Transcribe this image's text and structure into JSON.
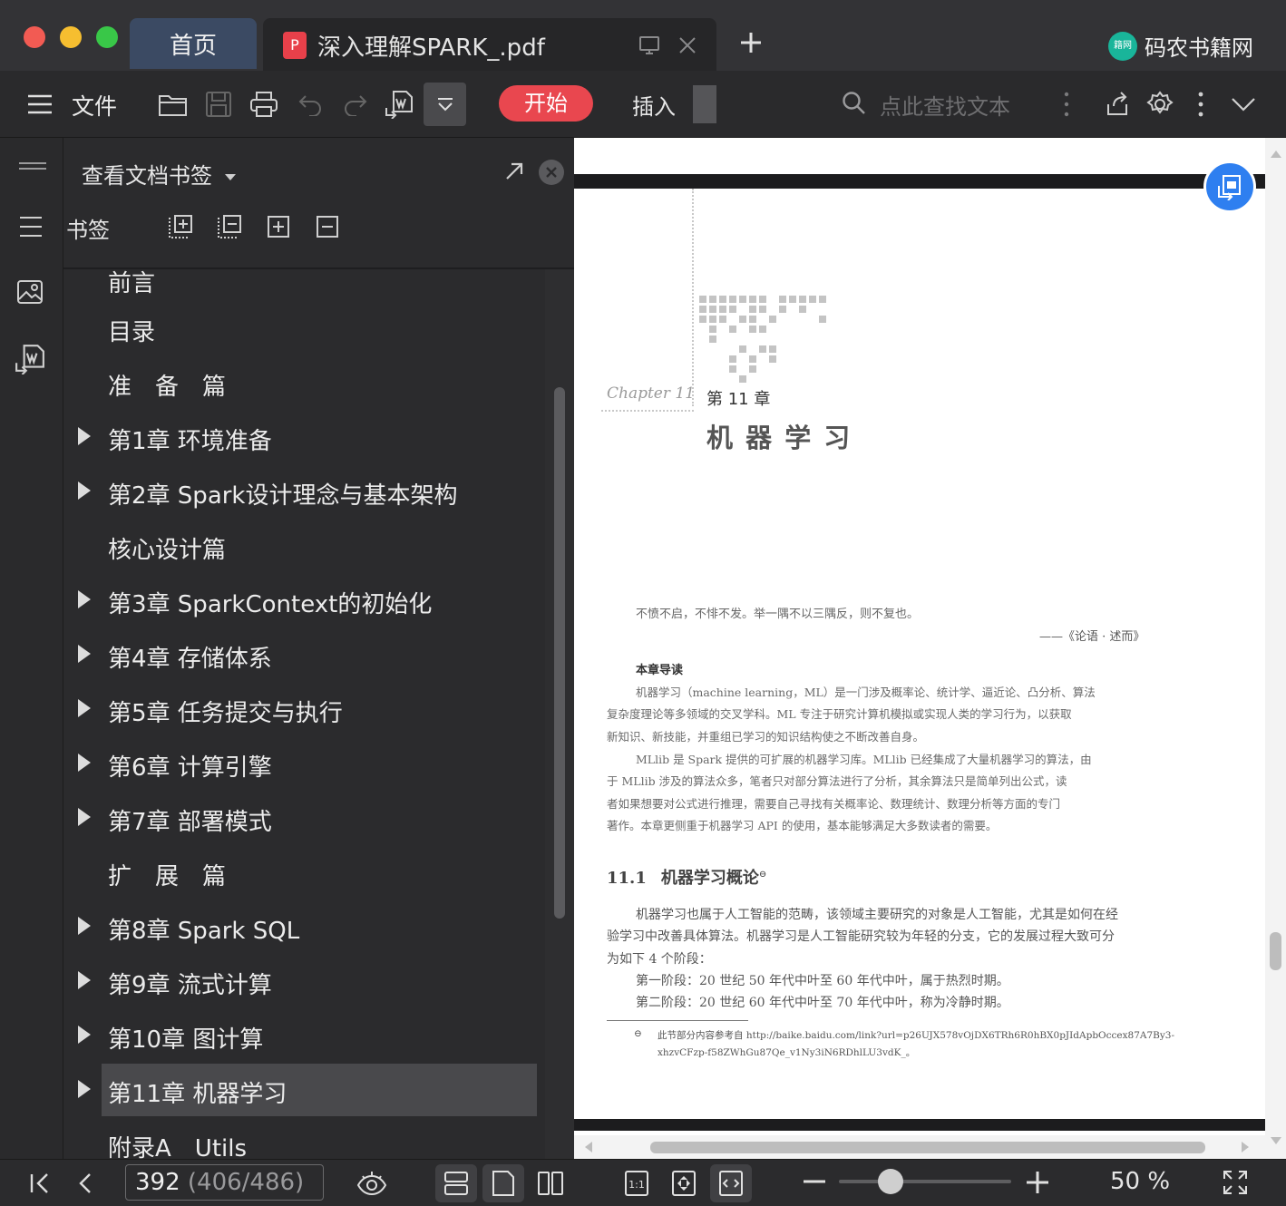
{
  "window": {
    "tabs": [
      {
        "label": "首页",
        "active": false
      },
      {
        "label": "深入理解SPARK_.pdf",
        "active": true
      }
    ],
    "brand": "码农书籍网",
    "brand_logo_text": "籍网"
  },
  "toolbar": {
    "file_label": "文件",
    "start_label": "开始",
    "insert_label": "插入",
    "search_placeholder": "点此查找文本",
    "accent": "#e9474f"
  },
  "sidebar": {
    "title": "查看文档书签",
    "label": "书签",
    "items": [
      {
        "label": "前言",
        "expandable": false
      },
      {
        "label": "目录",
        "expandable": false
      },
      {
        "label": "准　备　篇",
        "expandable": false
      },
      {
        "label": "第1章 环境准备",
        "expandable": true
      },
      {
        "label": "第2章 Spark设计理念与基本架构",
        "expandable": true
      },
      {
        "label": "核心设计篇",
        "expandable": false
      },
      {
        "label": "第3章 SparkContext的初始化",
        "expandable": true
      },
      {
        "label": "第4章 存储体系",
        "expandable": true
      },
      {
        "label": "第5章 任务提交与执行",
        "expandable": true
      },
      {
        "label": "第6章 计算引擎",
        "expandable": true
      },
      {
        "label": "第7章 部署模式",
        "expandable": true
      },
      {
        "label": "扩　展　篇",
        "expandable": false
      },
      {
        "label": "第8章 Spark SQL",
        "expandable": true
      },
      {
        "label": "第9章 流式计算",
        "expandable": true
      },
      {
        "label": "第10章 图计算",
        "expandable": true
      },
      {
        "label": "第11章 机器学习",
        "expandable": true,
        "selected": true
      },
      {
        "label": "附录A　Utils",
        "expandable": false
      }
    ]
  },
  "page": {
    "chapter_script": "Chapter 11",
    "chapter_num": "第 11 章",
    "chapter_title": "机 器 学 习",
    "quote": "不愤不启，不悱不发。举一隅不以三隅反，则不复也。",
    "quote_source": "——《论语 · 述而》",
    "intro_heading": "本章导读",
    "intro_p1_l1": "机器学习（machine learning，ML）是一门涉及概率论、统计学、逼近论、凸分析、算法",
    "intro_p1_l2": "复杂度理论等多领域的交叉学科。ML 专注于研究计算机模拟或实现人类的学习行为，以获取",
    "intro_p1_l3": "新知识、新技能，并重组已学习的知识结构使之不断改善自身。",
    "intro_p2_l1": "MLlib 是 Spark 提供的可扩展的机器学习库。MLlib 已经集成了大量机器学习的算法，由",
    "intro_p2_l2": "于 MLlib 涉及的算法众多，笔者只对部分算法进行了分析，其余算法只是简单列出公式，读",
    "intro_p2_l3": "者如果想要对公式进行推理，需要自己寻找有关概率论、数理统计、数理分析等方面的专门",
    "intro_p2_l4": "著作。本章更侧重于机器学习 API 的使用，基本能够满足大多数读者的需要。",
    "section_num": "11.1",
    "section_title": "机器学习概论",
    "footnote_mark": "⊖",
    "body_l1": "机器学习也属于人工智能的范畴，该领域主要研究的对象是人工智能，尤其是如何在经",
    "body_l2": "验学习中改善具体算法。机器学习是人工智能研究较为年轻的分支，它的发展过程大致可分",
    "body_l3": "为如下 4 个阶段：",
    "body_l4": "第一阶段：20 世纪 50 年代中叶至 60 年代中叶，属于热烈时期。",
    "body_l5": "第二阶段：20 世纪 60 年代中叶至 70 年代中叶，称为冷静时期。",
    "fn_l1": "此节部分内容参考自 http://baike.baidu.com/link?url=p26UJX578vOjDX6TRh6R0hBX0pJIdApbOccex87A7By3-",
    "fn_l2": "xhzvCFzp-f58ZWhGu87Qe_v1Ny3iN6RDhlLU3vdK_。"
  },
  "status": {
    "page_current": "392",
    "page_info": "(406/486)",
    "zoom": "50 %",
    "zoom_fraction": 0.3
  }
}
